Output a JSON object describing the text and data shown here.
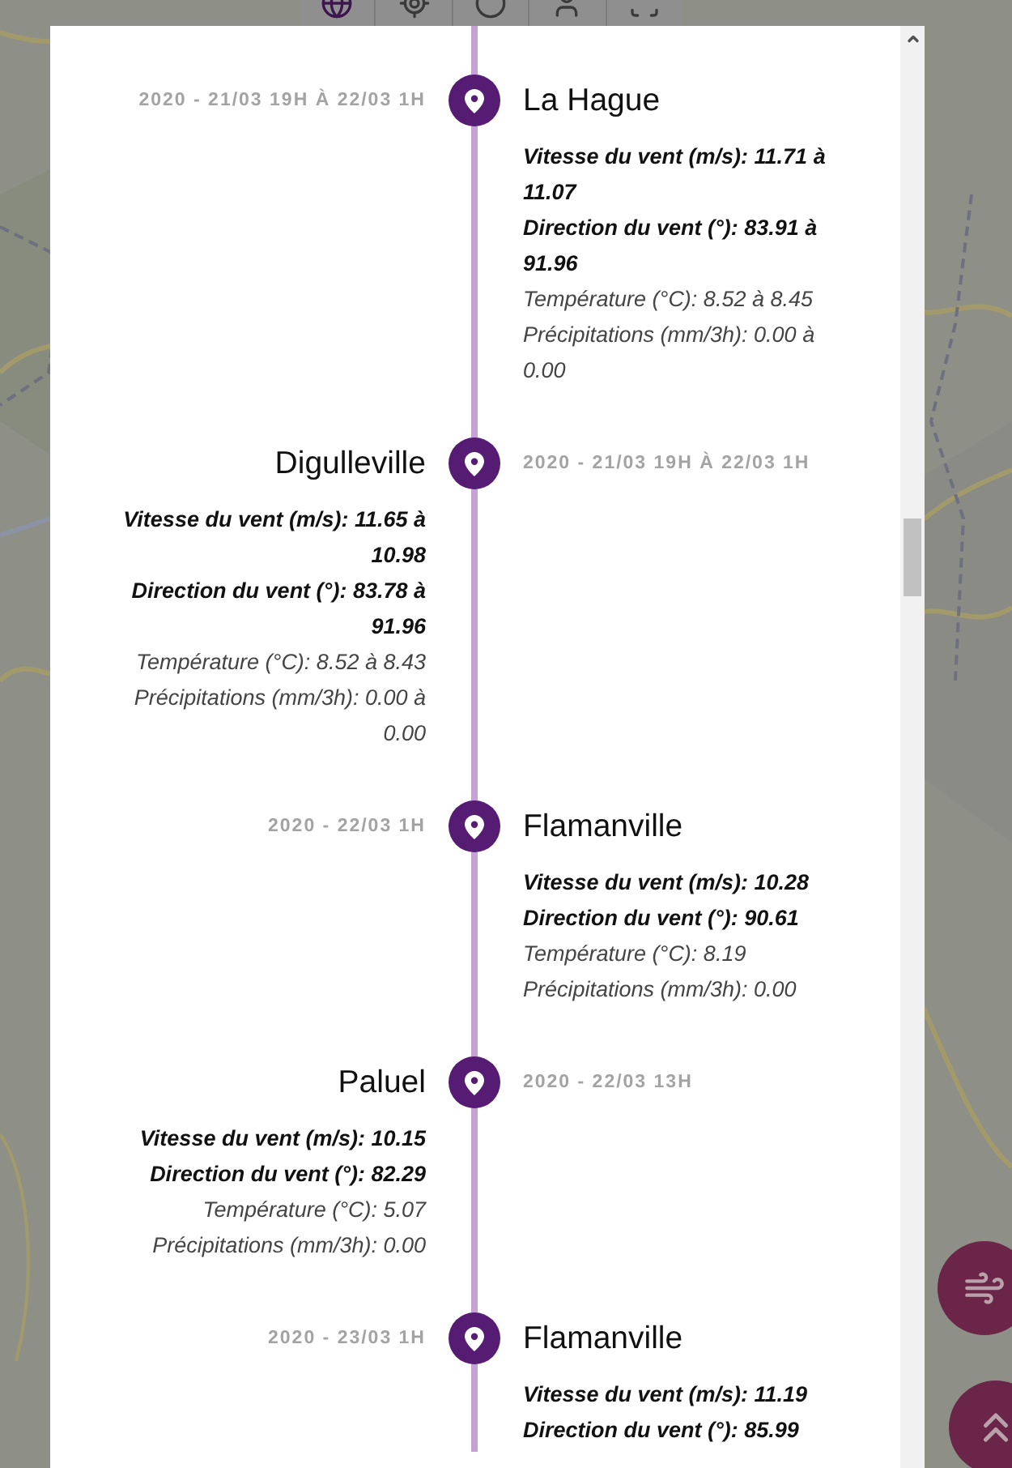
{
  "timeline": {
    "events": [
      {
        "kind": "right",
        "date": "2020 - 21/03 19H À 22/03 1H",
        "place": "La Hague",
        "details": [
          {
            "text": "Vitesse du vent (m/s): 11.71 à 11.07",
            "bold": true
          },
          {
            "text": "Direction du vent (°): 83.91 à 91.96",
            "bold": true
          },
          {
            "text": "Température (°C): 8.52 à 8.45",
            "bold": false
          },
          {
            "text": "Précipitations (mm/3h): 0.00 à 0.00",
            "bold": false
          }
        ]
      },
      {
        "kind": "left",
        "date": "2020 - 21/03 19H À 22/03 1H",
        "place": "Digulleville",
        "details": [
          {
            "text": "Vitesse du vent (m/s): 11.65 à 10.98",
            "bold": true
          },
          {
            "text": "Direction du vent (°): 83.78 à 91.96",
            "bold": true
          },
          {
            "text": "Température (°C): 8.52 à 8.43",
            "bold": false
          },
          {
            "text": "Précipitations (mm/3h): 0.00 à 0.00",
            "bold": false
          }
        ]
      },
      {
        "kind": "right",
        "date": "2020 - 22/03 1H",
        "place": "Flamanville",
        "details": [
          {
            "text": "Vitesse du vent (m/s): 10.28",
            "bold": true
          },
          {
            "text": "Direction du vent (°): 90.61",
            "bold": true
          },
          {
            "text": "Température (°C): 8.19",
            "bold": false
          },
          {
            "text": "Précipitations (mm/3h): 0.00",
            "bold": false
          }
        ]
      },
      {
        "kind": "left",
        "date": "2020 - 22/03 13H",
        "place": "Paluel",
        "details": [
          {
            "text": "Vitesse du vent (m/s): 10.15",
            "bold": true
          },
          {
            "text": "Direction du vent (°): 82.29",
            "bold": true
          },
          {
            "text": "Température (°C): 5.07",
            "bold": false
          },
          {
            "text": "Précipitations (mm/3h): 0.00",
            "bold": false
          }
        ]
      },
      {
        "kind": "right",
        "date": "2020 - 23/03 1H",
        "place": "Flamanville",
        "details": [
          {
            "text": "Vitesse du vent (m/s): 11.19",
            "bold": true
          },
          {
            "text": "Direction du vent (°): 85.99",
            "bold": true
          }
        ]
      }
    ]
  }
}
